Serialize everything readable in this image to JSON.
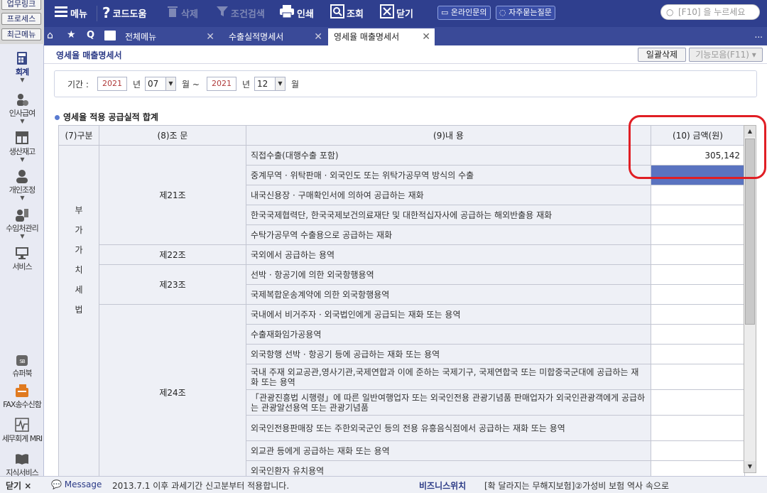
{
  "left_buttons": [
    "업무링크",
    "프로세스",
    "최근메뉴"
  ],
  "toolbar": {
    "menu": "메뉴",
    "code_help": "코드도움",
    "delete": "삭제",
    "cond_search": "조건검색",
    "print": "인쇄",
    "lookup": "조회",
    "close": "닫기",
    "online_inquiry": "온라인문의",
    "faq": "자주묻는질문",
    "search_placeholder": "[F10] 을 누르세요"
  },
  "tabs": {
    "home_label": "전체메뉴",
    "tab1": "수출실적명세서",
    "tab2": "영세율 매출명세서",
    "more": "..."
  },
  "sidebar": [
    {
      "label": "회계",
      "icon": "calculator-icon"
    },
    {
      "label": "인사급여",
      "icon": "people-coin-icon"
    },
    {
      "label": "생산재고",
      "icon": "box-grid-icon"
    },
    {
      "label": "개인조정",
      "icon": "person-icon"
    },
    {
      "label": "수임처관리",
      "icon": "person-building-icon"
    },
    {
      "label": "서비스",
      "icon": "monitor-icon"
    },
    {
      "label": "슈퍼북",
      "icon": "sb-bag-icon"
    },
    {
      "label": "FAX송수신함",
      "icon": "fax-icon"
    },
    {
      "label": "세무회계 MRI",
      "icon": "heartbeat-icon"
    },
    {
      "label": "지식서비스",
      "icon": "book-icon"
    }
  ],
  "page": {
    "title": "영세율 매출명세서",
    "bulk_delete": "일괄삭제",
    "func_collection": "기능모음(F11)"
  },
  "period": {
    "label": "기간 :",
    "from_year": "2021",
    "from_month": "07",
    "to_year": "2021",
    "to_month": "12",
    "year_unit": "년",
    "month_unit_tilde": "월 ~",
    "month_unit": "월"
  },
  "section_title": "영세율 적용 공급실적 합계",
  "table": {
    "headers": [
      "(7)구분",
      "(8)조 문",
      "(9)내 용",
      "(10) 금액(원)"
    ],
    "gubun": [
      "부",
      "가",
      "가",
      "치",
      "세",
      "법"
    ],
    "articles": [
      "제21조",
      "제22조",
      "제23조",
      "제24조"
    ],
    "rows": [
      {
        "desc": "직접수출(대행수출 포함)",
        "amount": "305,142"
      },
      {
        "desc": "중계무역 · 위탁판매 · 외국인도 또는 위탁가공무역 방식의 수출",
        "amount": ""
      },
      {
        "desc": "내국신용장 · 구매확인서에 의하여 공급하는 재화",
        "amount": ""
      },
      {
        "desc": "한국국제협력단, 한국국제보건의료재단 및 대한적십자사에 공급하는 해외반출용 재화",
        "amount": ""
      },
      {
        "desc": "수탁가공무역 수출용으로 공급하는 재화",
        "amount": ""
      },
      {
        "desc": "국외에서 공급하는 용역",
        "amount": ""
      },
      {
        "desc": "선박 · 항공기에 의한 외국항행용역",
        "amount": ""
      },
      {
        "desc": "국제복합운송계약에 의한 외국항행용역",
        "amount": ""
      },
      {
        "desc": "국내에서 비거주자 · 외국법인에게 공급되는 재화 또는 용역",
        "amount": ""
      },
      {
        "desc": "수출재화임가공용역",
        "amount": ""
      },
      {
        "desc": "외국항행 선박 · 항공기 등에 공급하는 재화 또는 용역",
        "amount": ""
      },
      {
        "desc": "국내 주재 외교공관,영사기관,국제연합과 이에 준하는 국제기구, 국제연합국 또는 미합중국군대에 공급하는 재화 또는 용역",
        "amount": ""
      },
      {
        "desc": "「관광진흥법 시행령」에 따른 일반여행업자 또는 외국인전용 관광기념품 판매업자가 외국인관광객에게 공급하는 관광알선용역 또는 관광기념품",
        "amount": ""
      },
      {
        "desc": "외국인전용판매장 또는 주한외국군인 등의 전용 유흥음식점에서 공급하는 재화 또는 용역",
        "amount": ""
      },
      {
        "desc": "외교관 등에게 공급하는 재화 또는 용역",
        "amount": ""
      },
      {
        "desc": "외국인환자 유치용역",
        "amount": ""
      }
    ]
  },
  "status": {
    "close": "닫기 ×",
    "message_label": "Message",
    "message": "2013.7.1 이후 과세기간 신고분부터 적용합니다.",
    "biz_watch": "비즈니스위치",
    "news": "[확 달라지는 무해지보험]②가성비 보험 역사 속으로"
  },
  "colors": {
    "toolbar_bg": "#2f3f8e",
    "accent": "#e01e24",
    "selected_cell": "#5a73c0"
  }
}
